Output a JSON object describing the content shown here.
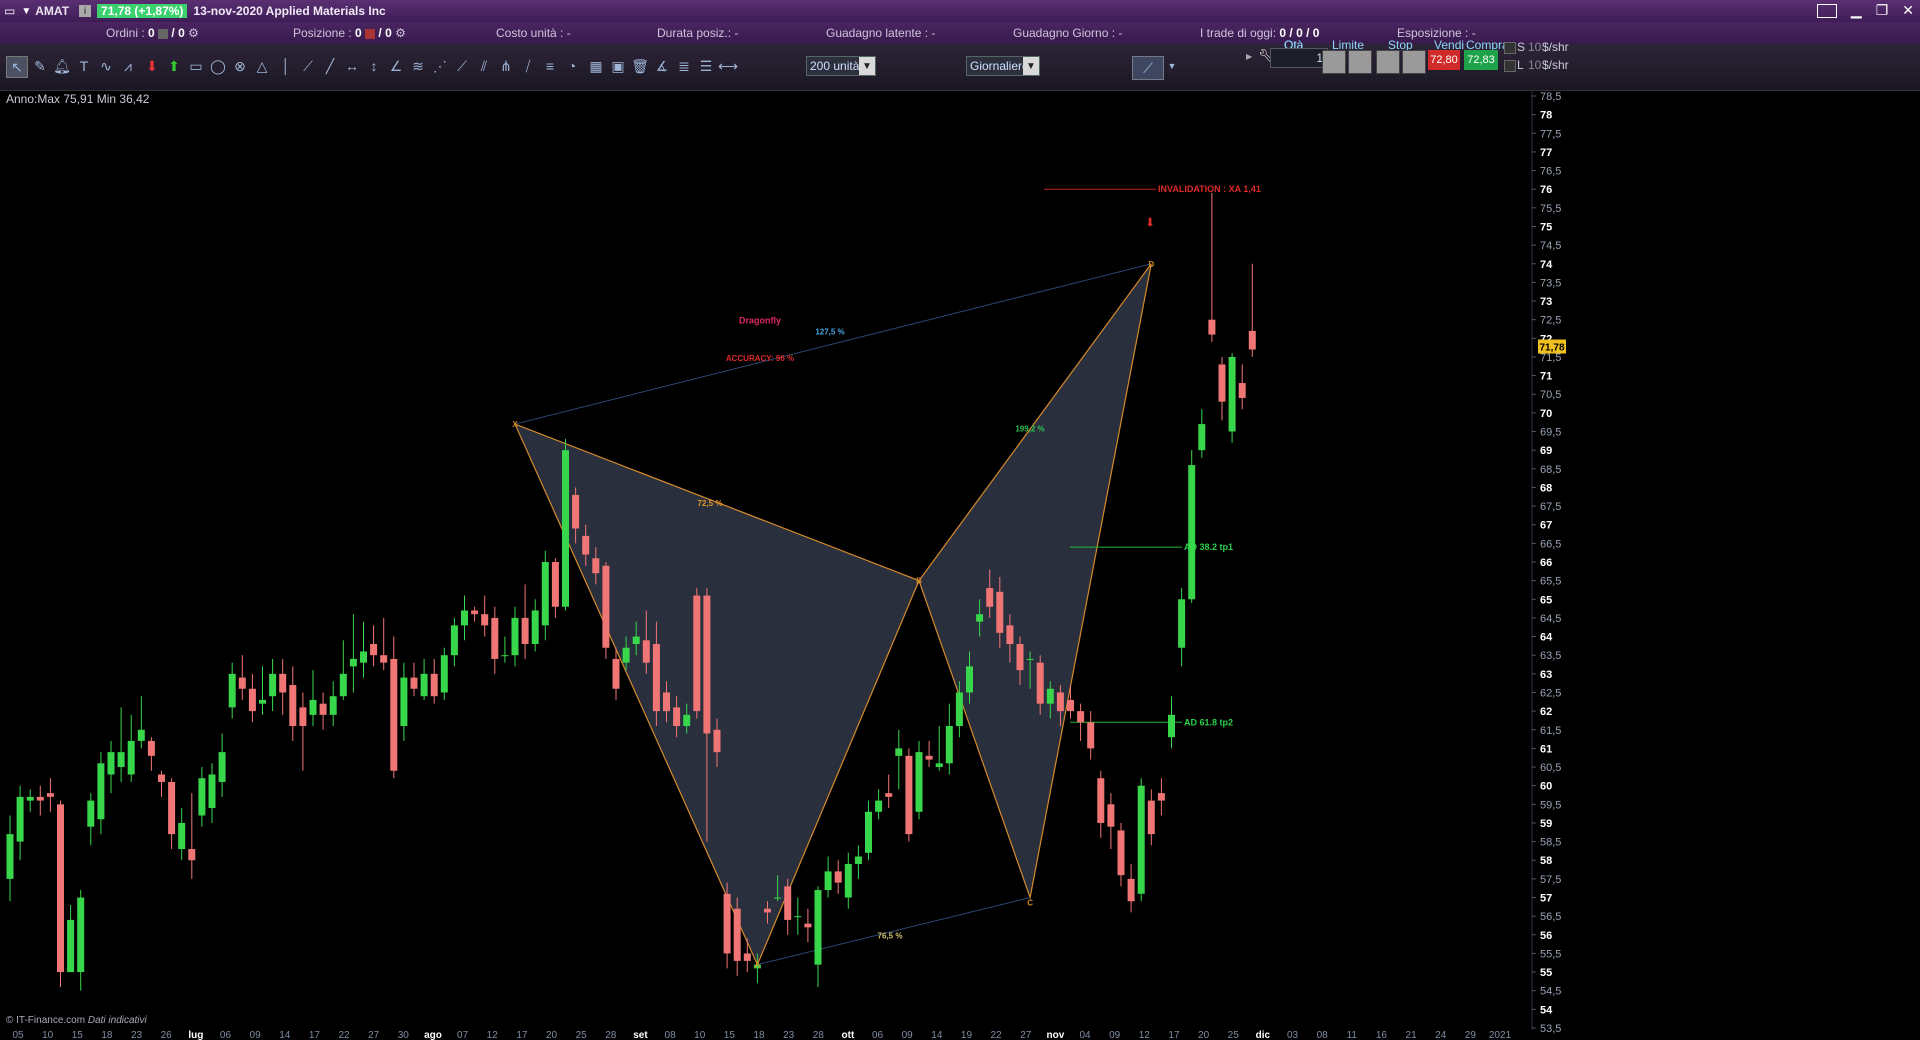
{
  "titlebar": {
    "symbol": "AMAT",
    "price_badge": "71,78 (+1,87%)",
    "title": "13-nov-2020 Applied Materials Inc"
  },
  "infobar": {
    "orders_label": "Ordini :",
    "orders_value": "0",
    "orders_value2": "/ 0",
    "position_label": "Posizione :",
    "position_value": "0",
    "position_value2": "/ 0",
    "cost_label": "Costo unità : -",
    "duration_label": "Durata posiz.: -",
    "unrealized_label": "Guadagno latente : -",
    "day_gain_label": "Guadagno Giorno : -",
    "trades_label": "I trade di oggi:",
    "trades_value": "0 / 0 / 0",
    "exposure_label": "Esposizione : -"
  },
  "toolbar": {
    "units_select": "200 unità",
    "period_select": "Giornaliero"
  },
  "trade_panel": {
    "qty_label": "Qtà",
    "qty_value": "1",
    "limit_label": "Limite",
    "stop_label": "Stop",
    "sell_label": "Vendi",
    "buy_label": "Compra",
    "sell_price": "72,80",
    "buy_price": "72,83",
    "s_label": "S",
    "l_label": "L",
    "s_qty": "10",
    "l_qty": "10",
    "unit_s": "$/shr",
    "unit_l": "$/shr"
  },
  "chart": {
    "range_text": "Anno:Max 75,91 Min 36,42",
    "footer": "© IT-Finance.com",
    "footer_note": "Dati indicativi"
  },
  "chart_data": {
    "type": "candlestick",
    "ylim": [
      53.5,
      78.5
    ],
    "current_price": "71,78",
    "y_ticks": [
      "78,5",
      "78",
      "77,5",
      "77",
      "76,5",
      "76",
      "75,5",
      "75",
      "74,5",
      "74",
      "73,5",
      "73",
      "72,5",
      "72",
      "71,5",
      "71",
      "70,5",
      "70",
      "69,5",
      "69",
      "68,5",
      "68",
      "67,5",
      "67",
      "66,5",
      "66",
      "65,5",
      "65",
      "64,5",
      "64",
      "63,5",
      "63",
      "62,5",
      "62",
      "61,5",
      "61",
      "60,5",
      "60",
      "59,5",
      "59",
      "58,5",
      "58",
      "57,5",
      "57",
      "56,5",
      "56",
      "55,5",
      "55",
      "54,5",
      "54",
      "53,5"
    ],
    "x_ticks": [
      "05",
      "10",
      "15",
      "18",
      "23",
      "26",
      "lug",
      "06",
      "09",
      "14",
      "17",
      "22",
      "27",
      "30",
      "ago",
      "07",
      "12",
      "17",
      "20",
      "25",
      "28",
      "set",
      "08",
      "10",
      "15",
      "18",
      "23",
      "28",
      "ott",
      "06",
      "09",
      "14",
      "19",
      "22",
      "27",
      "nov",
      "04",
      "09",
      "12",
      "17",
      "20",
      "25",
      "dic",
      "03",
      "08",
      "11",
      "16",
      "21",
      "24",
      "29",
      "2021"
    ],
    "candles": [
      [
        57.5,
        58.7,
        56.9,
        59.2
      ],
      [
        58.5,
        59.7,
        58.0,
        60.0
      ],
      [
        59.6,
        59.7,
        59.3,
        59.9
      ],
      [
        59.7,
        59.6,
        59.2,
        60.0
      ],
      [
        59.8,
        59.7,
        59.3,
        60.2
      ],
      [
        59.5,
        55.0,
        54.6,
        59.6
      ],
      [
        55.0,
        56.4,
        55.0,
        56.8
      ],
      [
        55.0,
        57.0,
        54.5,
        57.2
      ],
      [
        58.9,
        59.6,
        58.4,
        59.8
      ],
      [
        59.1,
        60.6,
        58.7,
        60.9
      ],
      [
        60.3,
        60.9,
        59.8,
        61.2
      ],
      [
        60.5,
        60.9,
        60.1,
        62.1
      ],
      [
        60.3,
        61.2,
        60.1,
        61.9
      ],
      [
        61.2,
        61.5,
        61.0,
        62.4
      ],
      [
        61.2,
        60.8,
        60.4,
        61.3
      ],
      [
        60.3,
        60.1,
        59.7,
        60.4
      ],
      [
        60.1,
        58.7,
        58.3,
        60.2
      ],
      [
        58.3,
        59.0,
        58.0,
        59.4
      ],
      [
        58.3,
        58.0,
        57.5,
        59.8
      ],
      [
        59.2,
        60.2,
        58.9,
        60.5
      ],
      [
        59.4,
        60.3,
        59.0,
        60.6
      ],
      [
        60.1,
        60.9,
        59.7,
        61.4
      ],
      [
        62.1,
        63.0,
        61.8,
        63.3
      ],
      [
        62.9,
        62.6,
        62.3,
        63.5
      ],
      [
        62.6,
        62.0,
        61.7,
        63.0
      ],
      [
        62.2,
        62.3,
        61.9,
        63.2
      ],
      [
        62.4,
        63.0,
        62.0,
        63.4
      ],
      [
        63.0,
        62.5,
        61.9,
        63.4
      ],
      [
        62.7,
        61.6,
        61.2,
        63.2
      ],
      [
        62.1,
        61.6,
        60.4,
        62.5
      ],
      [
        61.9,
        62.3,
        61.6,
        63.1
      ],
      [
        62.2,
        61.9,
        61.5,
        62.5
      ],
      [
        61.9,
        62.4,
        61.6,
        62.8
      ],
      [
        62.4,
        63.0,
        62.3,
        63.9
      ],
      [
        63.2,
        63.4,
        62.5,
        64.6
      ],
      [
        63.3,
        63.6,
        62.9,
        64.4
      ],
      [
        63.8,
        63.5,
        63.2,
        64.3
      ],
      [
        63.5,
        63.3,
        63.1,
        64.5
      ],
      [
        63.4,
        60.4,
        60.2,
        64.0
      ],
      [
        61.6,
        62.9,
        61.2,
        63.3
      ],
      [
        62.9,
        62.6,
        62.4,
        63.3
      ],
      [
        62.4,
        63.0,
        62.3,
        63.4
      ],
      [
        63.0,
        62.4,
        62.2,
        63.4
      ],
      [
        62.5,
        63.5,
        62.3,
        63.7
      ],
      [
        63.5,
        64.3,
        63.2,
        64.5
      ],
      [
        64.3,
        64.7,
        63.9,
        65.1
      ],
      [
        64.7,
        64.6,
        64.4,
        64.8
      ],
      [
        64.6,
        64.3,
        64.0,
        65.1
      ],
      [
        64.5,
        63.4,
        63.0,
        64.8
      ],
      [
        63.5,
        63.5,
        63.3,
        64.0
      ],
      [
        63.5,
        64.5,
        63.2,
        64.8
      ],
      [
        64.5,
        63.8,
        63.4,
        65.4
      ],
      [
        63.8,
        64.7,
        63.6,
        65.0
      ],
      [
        64.3,
        66.0,
        63.9,
        66.3
      ],
      [
        66.0,
        64.8,
        64.5,
        66.1
      ],
      [
        64.8,
        69.0,
        64.7,
        69.3
      ],
      [
        67.8,
        66.9,
        66.5,
        68.0
      ],
      [
        66.7,
        66.2,
        65.9,
        67.0
      ],
      [
        66.1,
        65.7,
        65.4,
        66.4
      ],
      [
        65.9,
        63.7,
        63.4,
        66.0
      ],
      [
        63.4,
        62.6,
        62.3,
        63.7
      ],
      [
        63.3,
        63.7,
        63.1,
        64.0
      ],
      [
        63.8,
        64.0,
        63.5,
        64.4
      ],
      [
        63.9,
        63.3,
        63.0,
        64.7
      ],
      [
        63.8,
        62.0,
        61.6,
        64.4
      ],
      [
        62.5,
        62.0,
        61.7,
        62.8
      ],
      [
        62.1,
        61.6,
        61.3,
        62.4
      ],
      [
        61.6,
        61.9,
        61.4,
        62.2
      ],
      [
        65.1,
        62.0,
        61.8,
        65.3
      ],
      [
        65.1,
        61.4,
        58.5,
        65.3
      ],
      [
        61.5,
        60.9,
        60.5,
        61.8
      ],
      [
        57.1,
        55.5,
        55.1,
        57.4
      ],
      [
        56.7,
        55.3,
        54.9,
        57.0
      ],
      [
        55.5,
        55.3,
        55.0,
        55.9
      ],
      [
        55.1,
        55.2,
        54.7,
        55.5
      ],
      [
        56.7,
        56.6,
        56.3,
        56.9
      ],
      [
        57.0,
        57.0,
        56.9,
        57.6
      ],
      [
        57.3,
        56.4,
        56.0,
        57.5
      ],
      [
        56.5,
        56.5,
        56.0,
        57.0
      ],
      [
        56.3,
        56.2,
        55.8,
        56.7
      ],
      [
        55.2,
        57.2,
        54.6,
        57.3
      ],
      [
        57.2,
        57.7,
        57.0,
        58.1
      ],
      [
        57.7,
        57.4,
        57.1,
        58.0
      ],
      [
        57.0,
        57.9,
        56.7,
        58.2
      ],
      [
        57.9,
        58.1,
        57.5,
        58.4
      ],
      [
        58.2,
        59.3,
        58.0,
        59.6
      ],
      [
        59.3,
        59.6,
        59.1,
        59.9
      ],
      [
        59.8,
        59.7,
        59.4,
        60.3
      ],
      [
        60.8,
        61.0,
        59.9,
        61.5
      ],
      [
        60.8,
        58.7,
        58.5,
        61.0
      ],
      [
        59.3,
        60.9,
        59.1,
        61.2
      ],
      [
        60.8,
        60.7,
        60.5,
        61.2
      ],
      [
        60.5,
        60.6,
        60.4,
        61.6
      ],
      [
        60.6,
        61.6,
        60.3,
        62.2
      ],
      [
        61.6,
        62.5,
        61.3,
        62.8
      ],
      [
        62.5,
        63.2,
        62.2,
        63.6
      ],
      [
        64.4,
        64.6,
        64.0,
        65.0
      ],
      [
        65.3,
        64.8,
        64.5,
        65.8
      ],
      [
        65.2,
        64.1,
        63.7,
        65.6
      ],
      [
        64.3,
        63.8,
        63.3,
        64.6
      ],
      [
        63.8,
        63.1,
        62.7,
        64.0
      ],
      [
        63.4,
        63.4,
        62.6,
        63.6
      ],
      [
        63.3,
        62.2,
        61.9,
        63.5
      ],
      [
        62.2,
        62.6,
        61.8,
        62.8
      ],
      [
        62.5,
        62.0,
        61.6,
        62.7
      ],
      [
        62.3,
        62.0,
        61.8,
        62.7
      ],
      [
        62.0,
        61.7,
        61.2,
        62.2
      ],
      [
        61.7,
        61.0,
        60.7,
        62.0
      ],
      [
        60.2,
        59.0,
        58.6,
        60.4
      ],
      [
        59.5,
        58.9,
        58.3,
        59.8
      ],
      [
        58.8,
        57.6,
        57.3,
        59.0
      ],
      [
        57.5,
        56.9,
        56.6,
        57.9
      ],
      [
        57.1,
        60.0,
        56.9,
        60.2
      ],
      [
        59.6,
        58.7,
        58.4,
        59.9
      ],
      [
        59.8,
        59.6,
        59.2,
        60.2
      ],
      [
        61.3,
        61.9,
        61.0,
        62.4
      ],
      [
        63.7,
        65.0,
        63.2,
        65.3
      ],
      [
        65.0,
        68.6,
        64.9,
        69.0
      ],
      [
        69.0,
        69.7,
        68.8,
        70.1
      ],
      [
        72.5,
        72.1,
        71.9,
        75.9
      ],
      [
        71.3,
        70.3,
        69.8,
        71.5
      ],
      [
        69.5,
        71.5,
        69.2,
        71.6
      ],
      [
        70.8,
        70.4,
        70.1,
        71.3
      ],
      [
        72.2,
        71.7,
        71.5,
        74.0
      ]
    ],
    "pattern": {
      "name": "Dragonfly",
      "accuracy_label": "ACCURACY: 96 %",
      "points": {
        "X": 69.7,
        "A": 55.2,
        "B": 65.5,
        "C": 57.0,
        "D": 74.0
      },
      "ratios": [
        "127,5 %",
        "72,5 %",
        "199,2 %",
        "76,5 %"
      ],
      "invalidation_label": "INVALIDATION : XA 1,41",
      "invalidation_price": 76.0,
      "targets": [
        {
          "label": "AD 38.2 tp1",
          "price": 66.4
        },
        {
          "label": "AD 61.8 tp2",
          "price": 61.7
        }
      ]
    }
  }
}
